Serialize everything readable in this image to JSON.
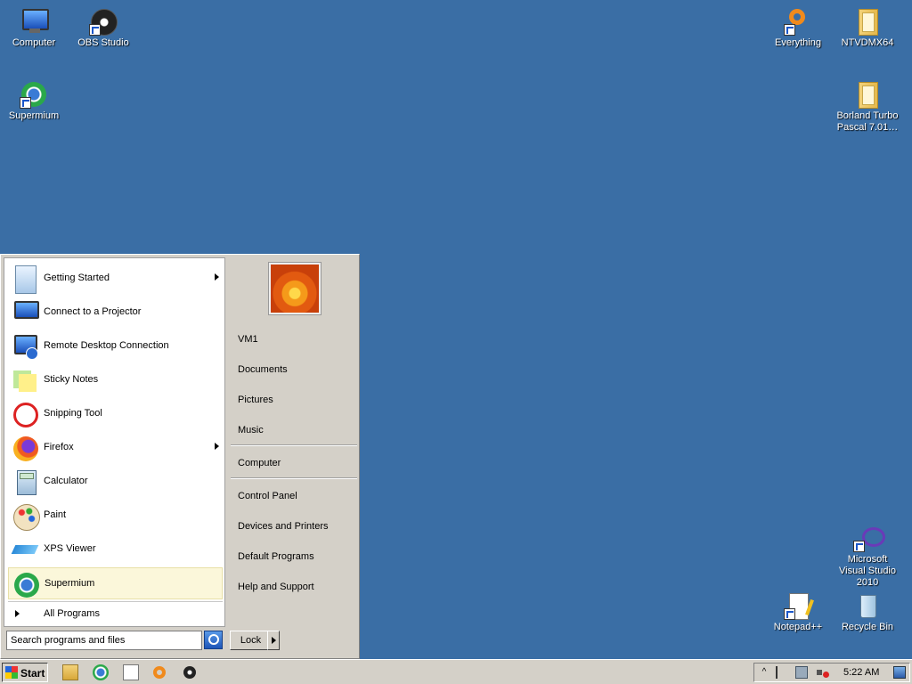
{
  "desktop": {
    "icons": {
      "computer": "Computer",
      "obs": "OBS Studio",
      "supermium": "Supermium",
      "everything": "Everything",
      "ntvdm": "NTVDMX64",
      "borland": "Borland Turbo Pascal 7.01…",
      "msvs": "Microsoft Visual Studio 2010",
      "notepadpp": "Notepad++",
      "recycle": "Recycle Bin"
    }
  },
  "start_menu": {
    "programs": [
      {
        "label": "Getting Started",
        "icon": "getting-started-icon"
      },
      {
        "label": "Connect to a Projector",
        "icon": "projector-icon"
      },
      {
        "label": "Remote Desktop Connection",
        "icon": "remote-desktop-icon"
      },
      {
        "label": "Sticky Notes",
        "icon": "sticky-notes-icon"
      },
      {
        "label": "Snipping Tool",
        "icon": "scissors-icon"
      },
      {
        "label": "Firefox",
        "icon": "firefox-icon"
      },
      {
        "label": "Calculator",
        "icon": "calculator-icon"
      },
      {
        "label": "Paint",
        "icon": "paint-palette-icon"
      },
      {
        "label": "XPS Viewer",
        "icon": "xps-viewer-icon"
      },
      {
        "label": "Supermium",
        "icon": "supermium-icon"
      }
    ],
    "all_programs": "All Programs",
    "search_placeholder": "Search programs and files",
    "right": {
      "user": "VM1",
      "documents": "Documents",
      "pictures": "Pictures",
      "music": "Music",
      "computer": "Computer",
      "control_panel": "Control Panel",
      "devices": "Devices and Printers",
      "default_programs": "Default Programs",
      "help": "Help and Support"
    },
    "lock_label": "Lock"
  },
  "taskbar": {
    "start_label": "Start",
    "clock": "5:22 AM"
  },
  "colors": {
    "desktop": "#3a6ea5",
    "chrome": "#d4d0c8",
    "selected_item": "#fbf7da"
  }
}
